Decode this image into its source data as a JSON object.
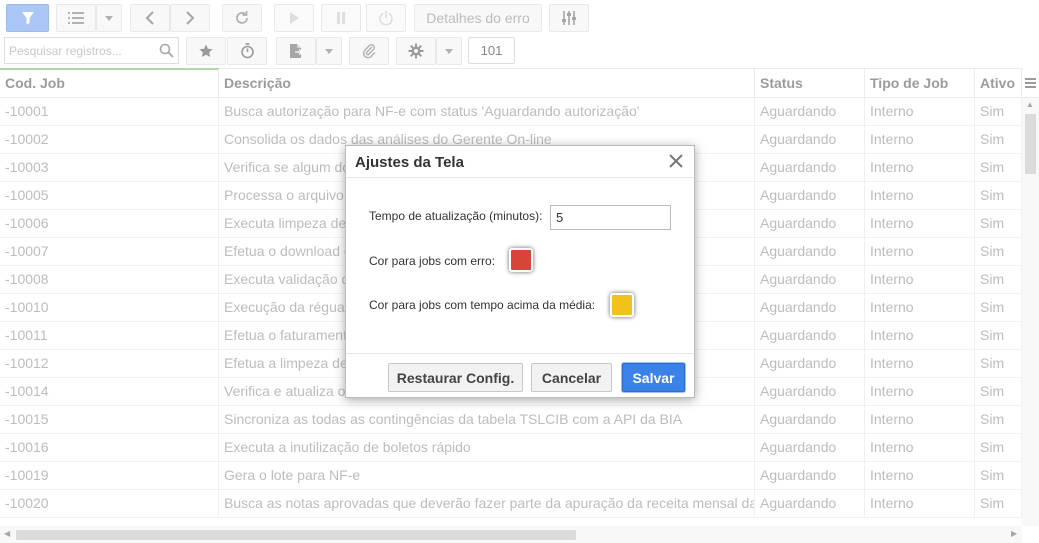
{
  "toolbar": {
    "error_details_label": "Detalhes do erro",
    "search_placeholder": "Pesquisar registros...",
    "record_count": "101"
  },
  "grid": {
    "columns": [
      "Cod. Job",
      "Descrição",
      "Status",
      "Tipo de Job",
      "Ativo"
    ],
    "rows": [
      [
        "-10001",
        "Busca autorização para NF-e com status 'Aguardando autorização'",
        "Aguardando",
        "Interno",
        "Sim"
      ],
      [
        "-10002",
        "Consolida os dados das análises do Gerente On-line",
        "Aguardando",
        "Interno",
        "Sim"
      ],
      [
        "-10003",
        "Verifica se algum doc",
        "Aguardando",
        "Interno",
        "Sim"
      ],
      [
        "-10005",
        "Processa o arquivo d",
        "Aguardando",
        "Interno",
        "Sim"
      ],
      [
        "-10006",
        "Executa limpeza de r",
        "Aguardando",
        "Interno",
        "Sim"
      ],
      [
        "-10007",
        "Efetua o download e",
        "Aguardando",
        "Interno",
        "Sim"
      ],
      [
        "-10008",
        "Executa validação de",
        "Aguardando",
        "Interno",
        "Sim"
      ],
      [
        "-10010",
        "Execução da régua d",
        "Aguardando",
        "Interno",
        "Sim"
      ],
      [
        "-10011",
        "Efetua o faturamento",
        "Aguardando",
        "Interno",
        "Sim"
      ],
      [
        "-10012",
        "Efetua a limpeza de r",
        "Aguardando",
        "Interno",
        "Sim"
      ],
      [
        "-10014",
        "Verifica e atualiza o r",
        "Aguardando",
        "Interno",
        "Sim"
      ],
      [
        "-10015",
        "Sincroniza as todas as contingências da tabela TSLCIB com a API da BIA",
        "Aguardando",
        "Interno",
        "Sim"
      ],
      [
        "-10016",
        "Executa a inutilização de boletos rápido",
        "Aguardando",
        "Interno",
        "Sim"
      ],
      [
        "-10019",
        "Gera o lote para NF-e",
        "Aguardando",
        "Interno",
        "Sim"
      ],
      [
        "-10020",
        "Busca as notas aprovadas que deverão fazer parte da apuração da receita mensal da empresa",
        "Aguardando",
        "Interno",
        "Sim"
      ]
    ]
  },
  "dialog": {
    "title": "Ajustes da Tela",
    "refresh_label": "Tempo de atualização (minutos):",
    "refresh_value": "5",
    "error_color_label": "Cor para jobs com erro:",
    "error_color": "#d9443a",
    "slow_color_label": "Cor para jobs com tempo acima da média:",
    "slow_color": "#f1c21b",
    "restore_label": "Restaurar Config.",
    "cancel_label": "Cancelar",
    "save_label": "Salvar"
  }
}
